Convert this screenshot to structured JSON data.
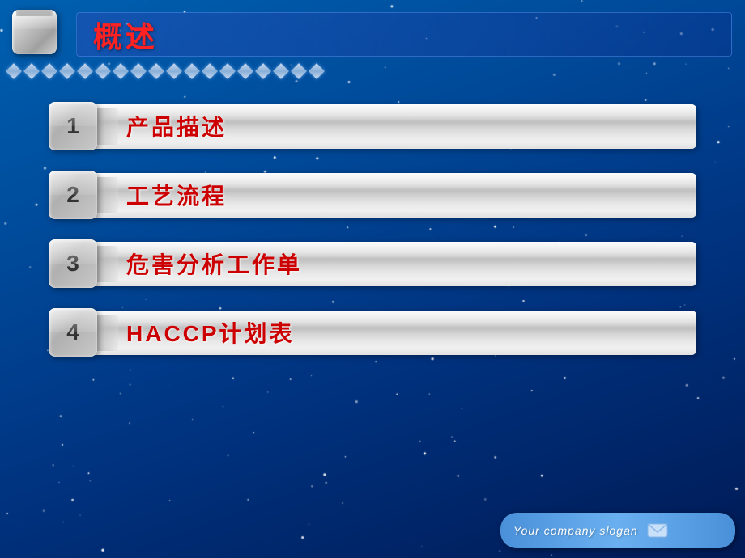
{
  "header": {
    "title": "概述",
    "logo_alt": "3D Box Logo"
  },
  "menu_items": [
    {
      "id": 1,
      "number": "1",
      "label": "产品描述"
    },
    {
      "id": 2,
      "number": "2",
      "label": "工艺流程"
    },
    {
      "id": 3,
      "number": "3",
      "label": "危害分析工作单"
    },
    {
      "id": 4,
      "number": "4",
      "label": "HACCP计划表"
    }
  ],
  "diamonds": {
    "count": 18
  },
  "slogan": {
    "text": "Your company slogan",
    "icon": "✉"
  },
  "colors": {
    "title_color": "#ff2222",
    "label_color": "#cc0000",
    "bg_from": "#0060b0",
    "bg_to": "#001a55"
  }
}
